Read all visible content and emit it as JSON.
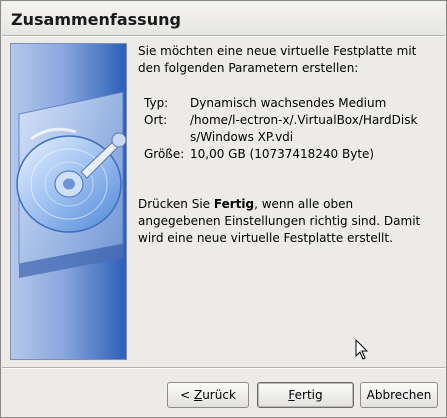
{
  "header": {
    "title": "Zusammenfassung"
  },
  "content": {
    "intro": "Sie möchten eine neue virtuelle Festplatte mit den folgenden Parametern erstellen:",
    "params": [
      {
        "label": "Typ:",
        "value": "Dynamisch wachsendes Medium"
      },
      {
        "label": "Ort:",
        "value": "/home/l-ectron-x/.VirtualBox/HardDisks/Windows XP.vdi"
      },
      {
        "label": "Größe:",
        "value": "10,00 GB (10737418240 Byte)"
      }
    ],
    "outro_prefix": "Drücken Sie ",
    "outro_bold": "Fertig",
    "outro_suffix": ", wenn alle oben angegebenen Einstellungen richtig sind. Damit wird eine neue virtuelle Festplatte erstellt."
  },
  "buttons": {
    "back_prefix": "< ",
    "back_mnemonic": "Z",
    "back_rest": "urück",
    "finish_mnemonic": "F",
    "finish_rest": "ertig",
    "cancel_label": "Abbrechen"
  },
  "image": {
    "icon": "hard-disk-icon"
  }
}
